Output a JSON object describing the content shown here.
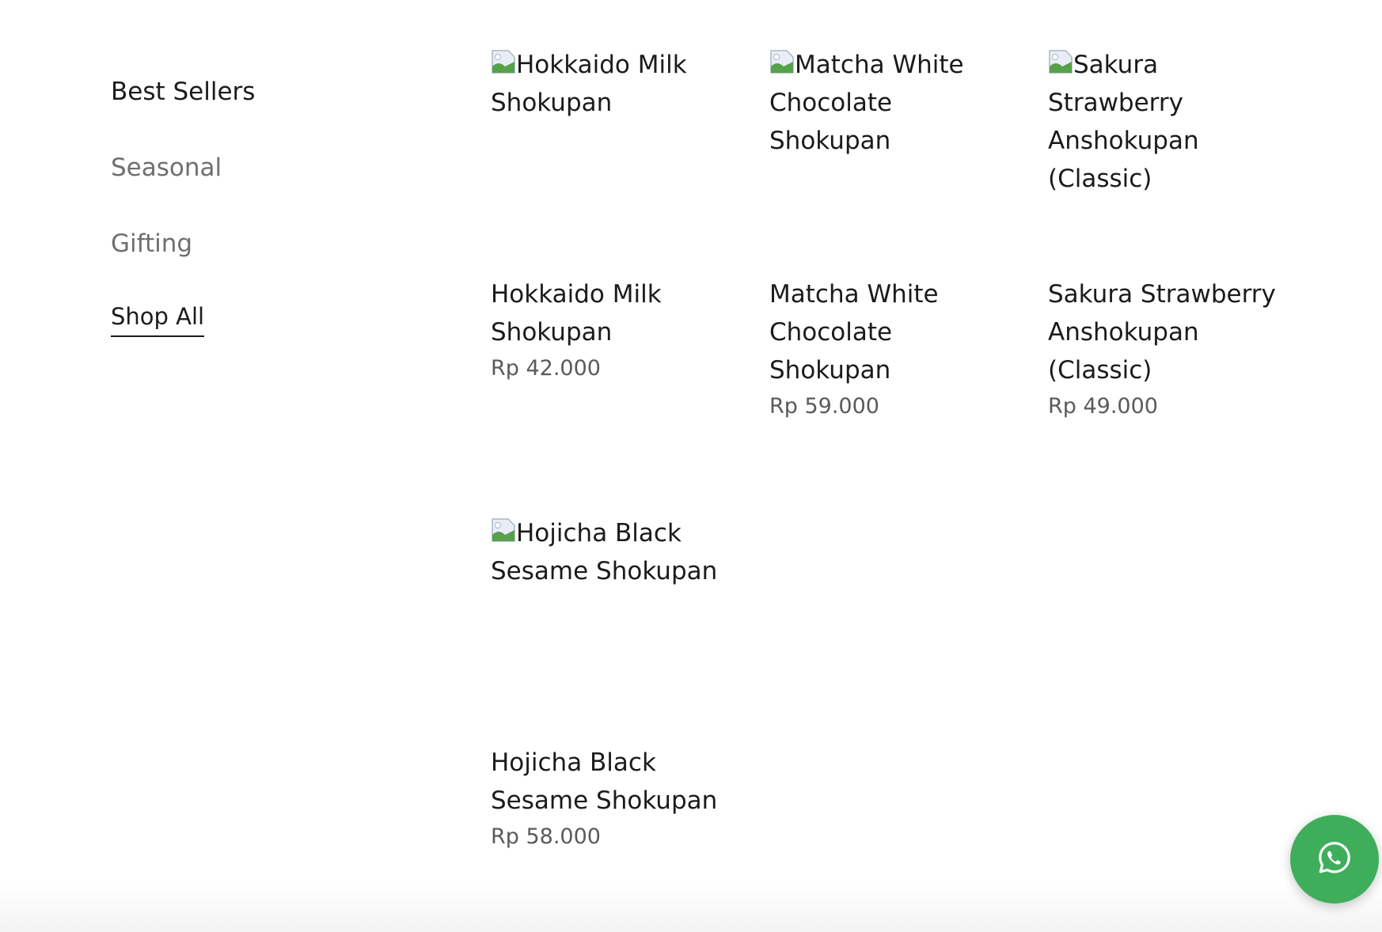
{
  "sidebar": {
    "categories": [
      {
        "label": "Best Sellers"
      },
      {
        "label": "Seasonal"
      },
      {
        "label": "Gifting"
      },
      {
        "label": "Shop All"
      }
    ]
  },
  "products": [
    {
      "image_alt": "Hokkaido Milk Shokupan",
      "title": "Hokkaido Milk Shokupan",
      "price": "Rp 42.000"
    },
    {
      "image_alt": "Matcha White Chocolate Shokupan",
      "title": "Matcha White Chocolate Shokupan",
      "price": "Rp 59.000"
    },
    {
      "image_alt": "Sakura Strawberry Anshokupan (Classic)",
      "title": "Sakura Strawberry Anshokupan (Classic)",
      "price": "Rp 49.000"
    },
    {
      "image_alt": "Hojicha Black Sesame Shokupan",
      "title": "Hojicha Black Sesame Shokupan",
      "price": "Rp 58.000"
    }
  ],
  "whatsapp": {
    "icon": "whatsapp-icon",
    "color": "#3fae5b"
  }
}
